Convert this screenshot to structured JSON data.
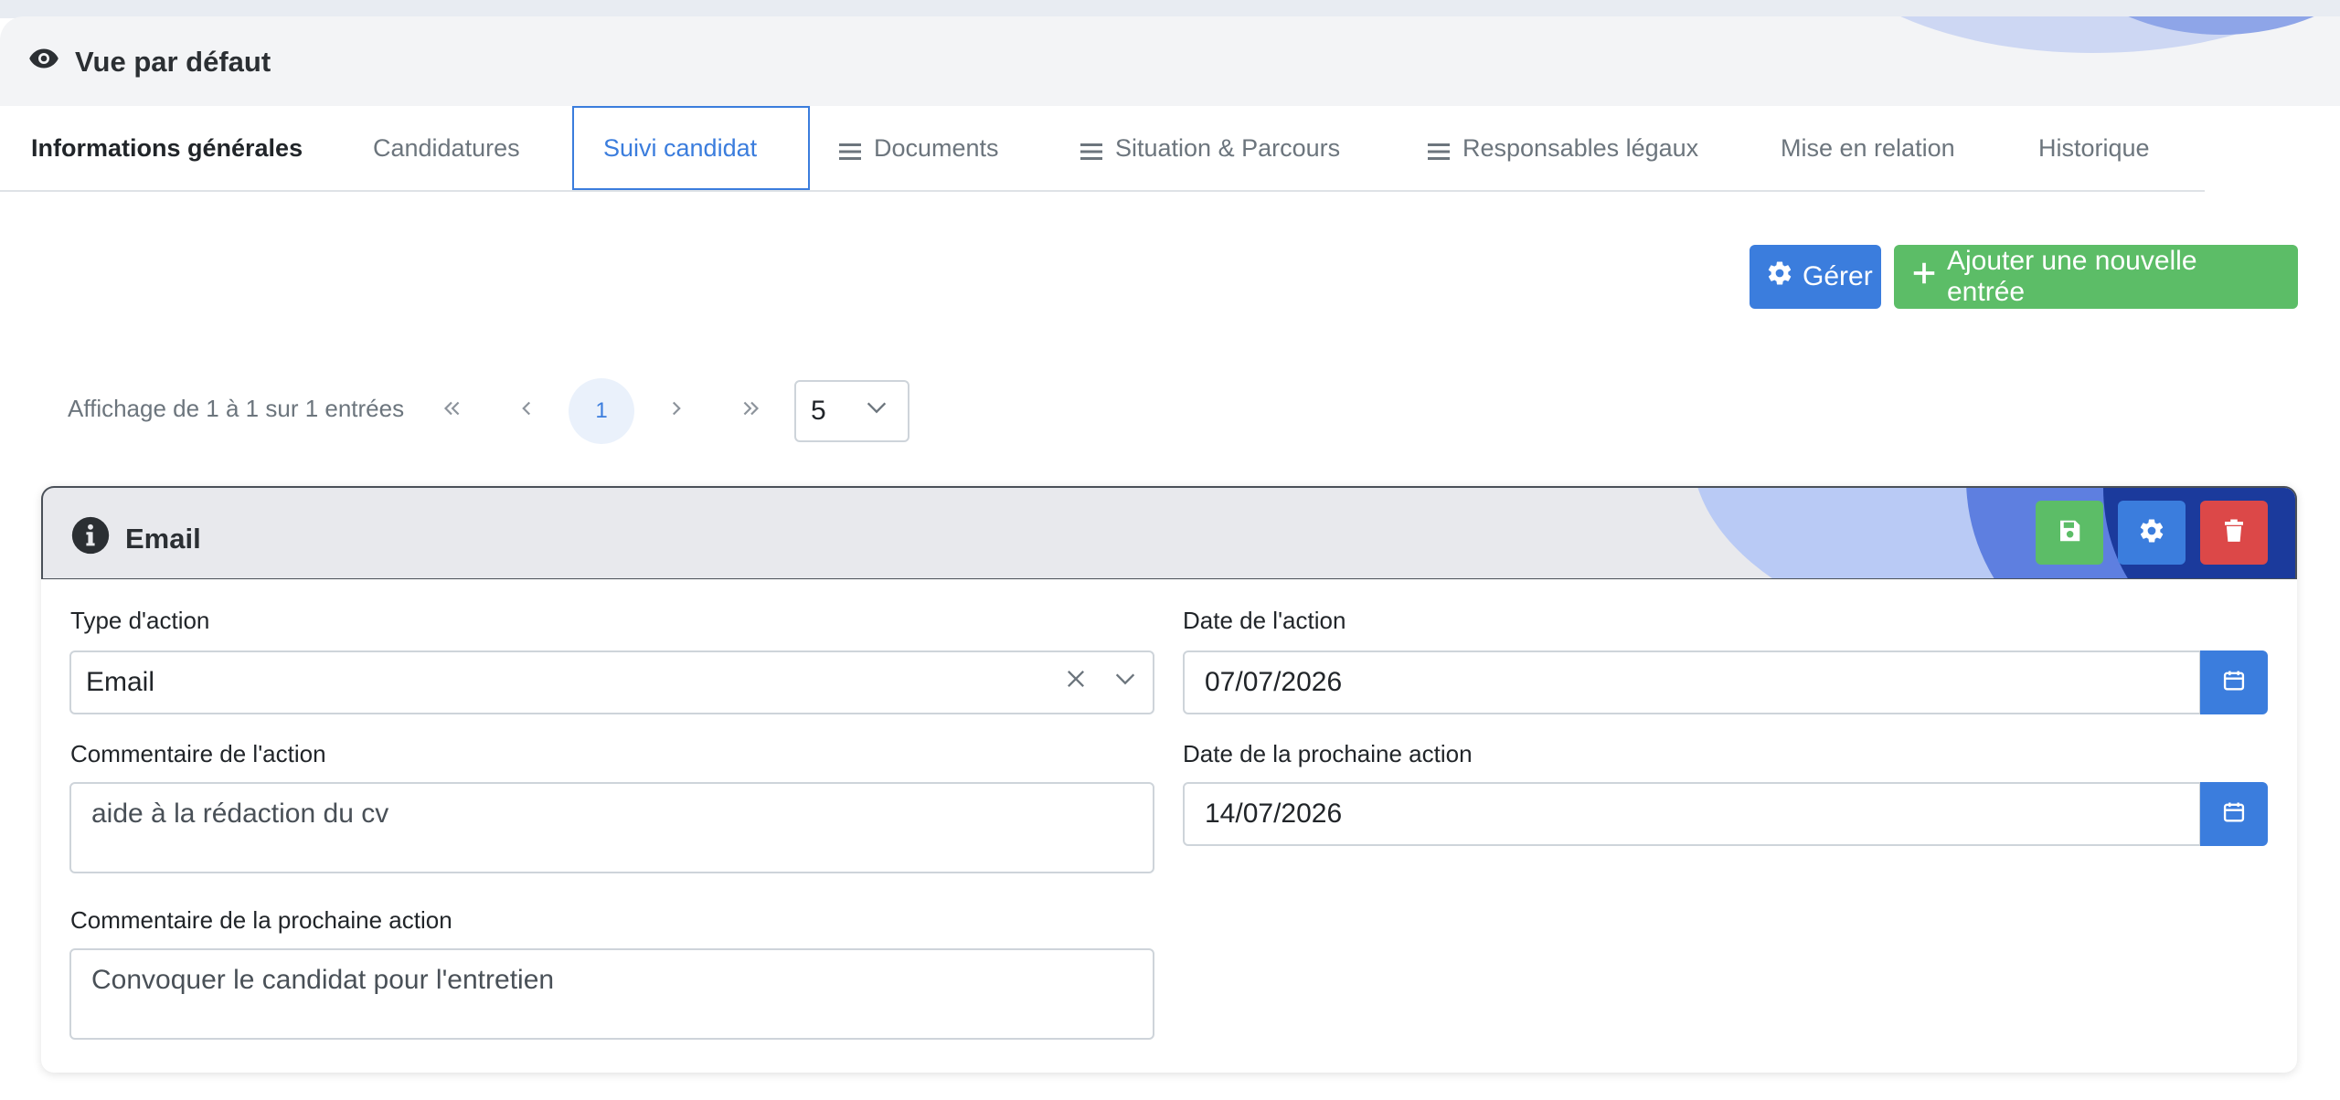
{
  "header": {
    "view_title": "Vue par défaut",
    "icon": "eye-icon"
  },
  "tabs": [
    {
      "label": "Informations générales",
      "icon": null,
      "active": false
    },
    {
      "label": "Candidatures",
      "icon": null,
      "active": false
    },
    {
      "label": "Suivi candidat",
      "icon": null,
      "active": true
    },
    {
      "label": "Documents",
      "icon": "list-icon",
      "active": false
    },
    {
      "label": "Situation & Parcours",
      "icon": "list-icon",
      "active": false
    },
    {
      "label": "Responsables légaux",
      "icon": "list-icon",
      "active": false
    },
    {
      "label": "Mise en relation",
      "icon": null,
      "active": false
    },
    {
      "label": "Historique",
      "icon": null,
      "active": false
    }
  ],
  "actions": {
    "manage_label": "Gérer",
    "add_label": "Ajouter une nouvelle entrée"
  },
  "pagination": {
    "info": "Affichage de 1 à 1 sur 1 entrées",
    "current_page": "1",
    "page_size": "5"
  },
  "entry": {
    "title": "Email",
    "type_label": "Type d'action",
    "type_value": "Email",
    "date_label": "Date de l'action",
    "date_value": "07/07/2026",
    "comment_label": "Commentaire de l'action",
    "comment_value": "aide à la rédaction du cv",
    "next_date_label": "Date de la prochaine action",
    "next_date_value": "14/07/2026",
    "next_comment_label": "Commentaire de la prochaine action",
    "next_comment_value": "Convoquer le candidat pour l'entretien"
  },
  "colors": {
    "primary": "#3b7ddd",
    "success": "#5cbd67",
    "danger": "#dc4848"
  }
}
